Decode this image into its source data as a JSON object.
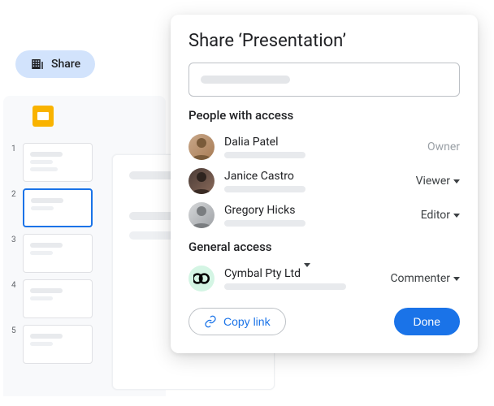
{
  "chip": {
    "label": "Share"
  },
  "dialog": {
    "title": "Share ‘Presentation’",
    "people_section": "People with access",
    "general_section": "General access",
    "people": [
      {
        "name": "Dalia Patel",
        "role": "Owner",
        "role_dropdown": false
      },
      {
        "name": "Janice Castro",
        "role": "Viewer",
        "role_dropdown": true
      },
      {
        "name": "Gregory Hicks",
        "role": "Editor",
        "role_dropdown": true
      }
    ],
    "general": {
      "org": "Cymbal Pty Ltd",
      "role": "Commenter"
    },
    "copy_link": "Copy link",
    "done": "Done"
  },
  "slides": {
    "thumbs": [
      "1",
      "2",
      "3",
      "4",
      "5"
    ],
    "selected_index": 1
  }
}
